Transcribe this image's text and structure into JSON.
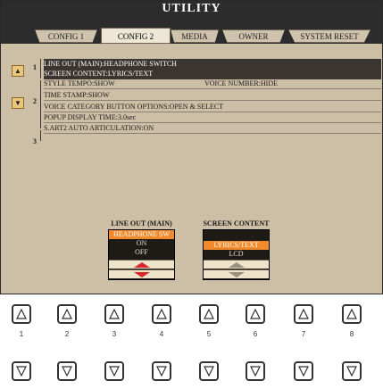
{
  "title": "UTILITY",
  "tabs": [
    {
      "label": "CONFIG 1",
      "active": false
    },
    {
      "label": "CONFIG 2",
      "active": true
    },
    {
      "label": "MEDIA",
      "active": false
    },
    {
      "label": "OWNER",
      "active": false
    },
    {
      "label": "SYSTEM RESET",
      "active": false
    }
  ],
  "groups": [
    "1",
    "2",
    "3"
  ],
  "items": [
    {
      "group": "1",
      "text": "LINE OUT (MAIN):HEADPHONE SWITCH",
      "selected": true
    },
    {
      "group": "1",
      "text": "SCREEN CONTENT:LYRICS/TEXT",
      "selected": true
    },
    {
      "group": "2",
      "text": "STYLE TEMPO:SHOW",
      "text_right": "VOICE NUMBER:HIDE",
      "selected": false
    },
    {
      "group": "2",
      "text": "TIME STAMP:SHOW",
      "selected": false
    },
    {
      "group": "2",
      "text": "VOICE CATEGORY BUTTON OPTIONS:OPEN & SELECT",
      "selected": false
    },
    {
      "group": "2",
      "text": "POPUP DISPLAY TIME:3.0sec",
      "selected": false
    },
    {
      "group": "3",
      "text": "S.ART2 AUTO ARTICULATION:ON",
      "selected": false
    }
  ],
  "selectors": [
    {
      "title": "LINE OUT (MAIN)",
      "options": [
        "HEADPHONE SW",
        "ON",
        "OFF"
      ],
      "selected": "HEADPHONE SW"
    },
    {
      "title": "SCREEN CONTENT",
      "options": [
        "LYRICS/TEXT",
        "LCD"
      ],
      "selected": "LYRICS/TEXT"
    }
  ],
  "panel_buttons": [
    "1",
    "2",
    "3",
    "4",
    "5",
    "6",
    "7",
    "8"
  ],
  "colors": {
    "screen_bg": "#cdbfa6",
    "title_bg": "#2c2c2c",
    "highlight": "#f08a2c",
    "selected_row": "#3a3530",
    "arrow_red": "#d9262a"
  }
}
